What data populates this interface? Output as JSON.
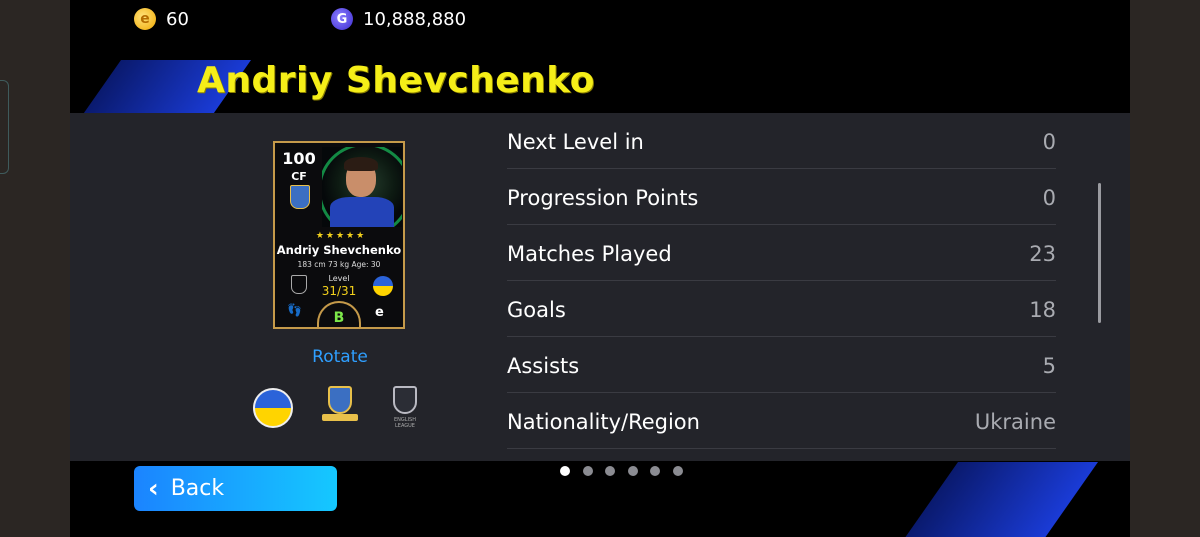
{
  "header": {
    "coins_value": "60",
    "coin_symbol": "e",
    "gp_value": "10,888,880",
    "gp_symbol": "G"
  },
  "player": {
    "title": "Andriy Shevchenko"
  },
  "card": {
    "rating": "100",
    "position": "CF",
    "stars": "★★★★★",
    "name": "Andriy Shevchenko",
    "meta": "183 cm  73 kg  Age: 30",
    "level_label": "Level",
    "level_value": "31/31",
    "grade": "B",
    "brand_glyph": "e"
  },
  "actions": {
    "rotate_label": "Rotate",
    "back_label": "Back"
  },
  "badges": {
    "league_text": "ENGLISH LEAGUE"
  },
  "stats": [
    {
      "label": "Next Level in",
      "value": "0"
    },
    {
      "label": "Progression Points",
      "value": "0"
    },
    {
      "label": "Matches Played",
      "value": "23"
    },
    {
      "label": "Goals",
      "value": "18"
    },
    {
      "label": "Assists",
      "value": "5"
    },
    {
      "label": "Nationality/Region",
      "value": "Ukraine"
    }
  ],
  "pagination": {
    "total": 6,
    "active_index": 0
  },
  "colors": {
    "title_yellow": "#f5ee18",
    "accent_blue": "#2f9fff",
    "panel_bg": "#23242a",
    "card_border": "#c59a4a"
  },
  "icons": {
    "coin": "coin-icon",
    "gp": "gp-icon",
    "back": "chevron-left-icon",
    "foot": "foot-icon"
  }
}
